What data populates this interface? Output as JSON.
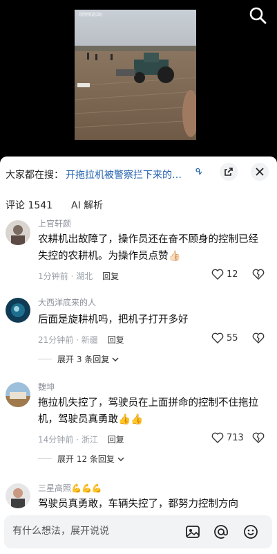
{
  "video": {
    "watermark": "视频频道(改)"
  },
  "hot_search": {
    "prefix": "大家都在搜：",
    "query": "开拖拉机被警察拦下来的…",
    "search_glyph": "ᕴ"
  },
  "tabs": {
    "comments_label": "评论 1541",
    "ai_label": "AI 解析"
  },
  "comments": [
    {
      "username": "上官轩颜",
      "text": "农耕机出故障了，操作员还在奋不顾身的控制已经失控的农耕机。为操作员点赞👍🏻",
      "time_location": "1分钟前 · 湖北",
      "reply_label": "回复",
      "likes": "12"
    },
    {
      "username": "大西洋底来的人",
      "text": "后面是旋耕机吗，把机子打开多好",
      "time_location": "21分钟前 · 新疆",
      "reply_label": "回复",
      "likes": "55",
      "expand_label": "展开 3 条回复"
    },
    {
      "username": "魏坤",
      "text": "拖拉机失控了，驾驶员在上面拼命的控制不住拖拉机，驾驶员真勇敢👍👍",
      "time_location": "14分钟前 · 浙江",
      "reply_label": "回复",
      "likes": "713",
      "expand_label": "展开 12 条回复"
    },
    {
      "username": "三星高照💪💪💪",
      "text": "驾驶员真勇敢，车辆失控了，都努力控制方向"
    }
  ],
  "input": {
    "placeholder": "有什么想法，展开说说"
  },
  "icons": {
    "search": "search-icon",
    "share": "share-icon",
    "close": "close-icon",
    "heart": "heart-icon",
    "broken_heart": "dislike-icon",
    "image": "image-icon",
    "at": "at-icon",
    "emoji": "emoji-icon"
  },
  "colors": {
    "link_blue": "#1f5fae",
    "meta_gray": "#9aa0a8"
  }
}
